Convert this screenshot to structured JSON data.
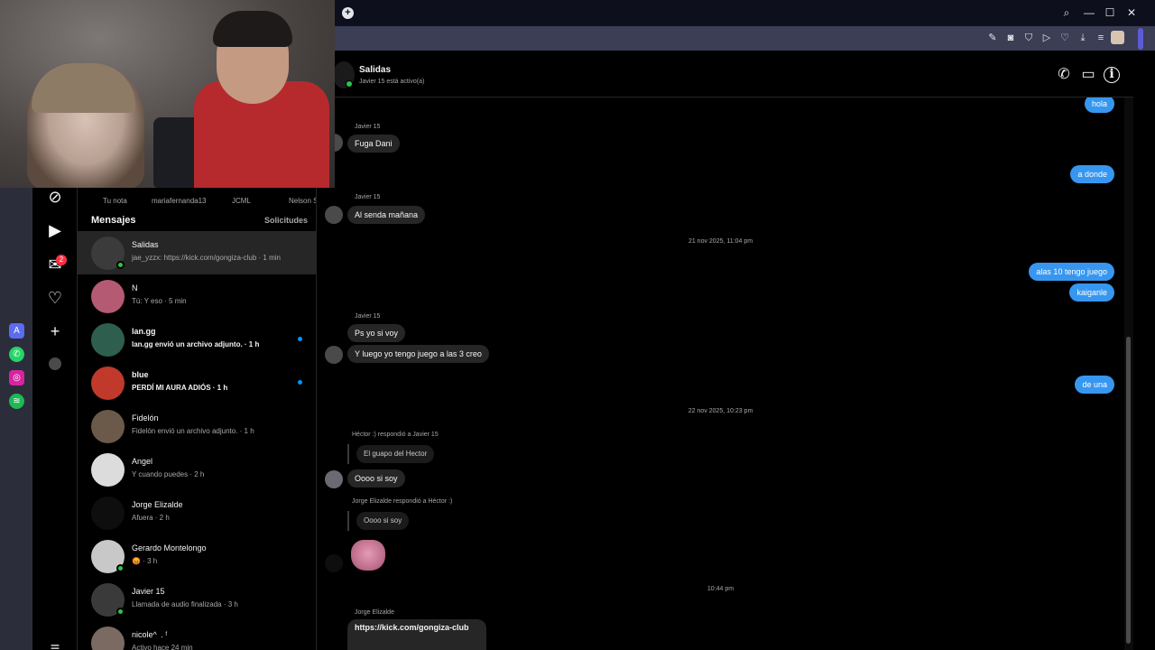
{
  "taskbar": {
    "icons": [
      "arc-icon",
      "whatsapp-icon",
      "instagram-icon",
      "spotify-icon"
    ]
  },
  "rail": {
    "icons": [
      "explore-icon",
      "reels-icon",
      "messenger-icon",
      "heart-icon",
      "create-icon",
      "profile-icon"
    ],
    "badge": "2"
  },
  "notes": {
    "items": [
      "Tu nota",
      "mariafernanda13",
      "JCML",
      "Nelson S"
    ]
  },
  "list": {
    "title": "Mensajes",
    "requests": "Solicitudes",
    "conversations": [
      {
        "name": "Salidas",
        "preview": "jae_yzzx: https://kick.com/gongiza-club · 1 min",
        "unread": false,
        "online": true,
        "active": true,
        "color": "#3b3b3b"
      },
      {
        "name": "N",
        "preview": "Tú: Y eso · 5 min",
        "unread": false,
        "online": false,
        "active": false,
        "color": "#b55a73"
      },
      {
        "name": "lan.gg",
        "preview": "lan.gg envió un archivo adjunto. · 1 h",
        "unread": true,
        "online": false,
        "active": false,
        "color": "#2e5e4e"
      },
      {
        "name": "blue",
        "preview": "PERDÍ MI AURA ADIÓS · 1 h",
        "unread": true,
        "online": false,
        "active": false,
        "color": "#c0392b"
      },
      {
        "name": "Fidelón",
        "preview": "Fidelón envió un archivo adjunto. · 1 h",
        "unread": false,
        "online": false,
        "active": false,
        "color": "#6b5a4a"
      },
      {
        "name": "Angel",
        "preview": "Y cuando puedes · 2 h",
        "unread": false,
        "online": false,
        "active": false,
        "color": "#dcdcdc"
      },
      {
        "name": "Jorge Elizalde",
        "preview": "Afuera · 2 h",
        "unread": false,
        "online": false,
        "active": false,
        "color": "#0e0e0e"
      },
      {
        "name": "Gerardo Montelongo",
        "preview": "😡 · 3 h",
        "unread": false,
        "online": true,
        "active": false,
        "color": "#c8c8c8"
      },
      {
        "name": "Javier 15",
        "preview": "Llamada de audio finalizada · 3 h",
        "unread": false,
        "online": true,
        "active": false,
        "color": "#3a3a3a"
      },
      {
        "name": "nicole^   . ᶠ",
        "preview": "Activo hace 24 min",
        "unread": false,
        "online": false,
        "active": false,
        "color": "#7a6a62"
      }
    ]
  },
  "chat": {
    "name": "Salidas",
    "status": "Javier 15 está activo(a)",
    "icons": [
      "phone-icon",
      "video-icon",
      "info-icon"
    ],
    "messages": {
      "m_hola": "hola",
      "s1": "Javier 15",
      "m_fuga": "Fuga Dani",
      "m_adonde": "a donde",
      "s2": "Javier 15",
      "m_senda": "Al senda mañana",
      "ts1": "21 nov 2025, 11:04 pm",
      "m_alas10": "alas 10 tengo juego",
      "m_kaiganle": "kaiganle",
      "s3": "Javier 15",
      "m_psyo": "Ps yo si voy",
      "m_luego": "Y luego yo tengo juego a las 3 creo",
      "m_deuna": "de una",
      "ts2": "22 nov 2025, 10:23 pm",
      "r1_label": "Héctor :) respondió a Javier 15",
      "r1_quote": "El guapo del Hector",
      "m_oooo1": "Oooo si soy",
      "r2_label": "Jorge Elizalde respondió a Héctor :)",
      "r2_quote": "Oooo si soy",
      "ts3": "10:44 pm",
      "s4": "Jorge Elizalde",
      "m_link": "https://kick.com/gongiza-club"
    }
  },
  "colors": {
    "outgoing": "#3797f0",
    "incoming": "#262626",
    "online": "#31c24d",
    "unread_dot": "#0095f6"
  }
}
